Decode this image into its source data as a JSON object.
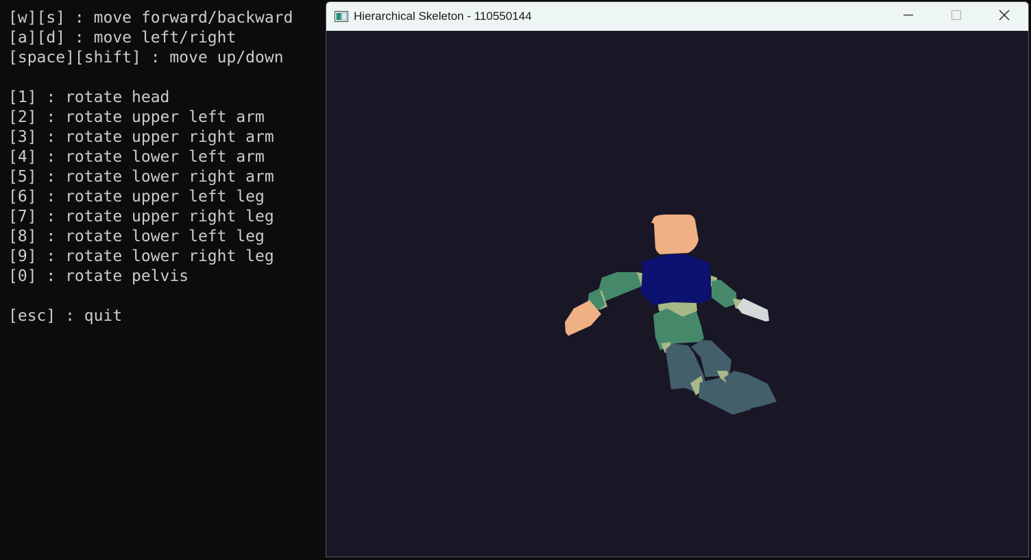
{
  "console": {
    "movement": [
      "[w][s] : move forward/backward",
      "[a][d] : move left/right",
      "[space][shift] : move up/down"
    ],
    "rotations": [
      "[1] : rotate head",
      "[2] : rotate upper left arm",
      "[3] : rotate upper right arm",
      "[4] : rotate lower left arm",
      "[5] : rotate lower right arm",
      "[6] : rotate upper left leg",
      "[7] : rotate upper right leg",
      "[8] : rotate lower left leg",
      "[9] : rotate lower right leg",
      "[0] : rotate pelvis"
    ],
    "quit": "[esc] : quit"
  },
  "window": {
    "title": "Hierarchical Skeleton - 110550144",
    "icon": "app-window-icon",
    "controls": [
      "minimize-icon",
      "maximize-icon",
      "close-icon"
    ]
  },
  "scene": {
    "background_color": "#191626",
    "colors": {
      "head": "#efb083",
      "torso": "#0d1170",
      "limb": "#45896a",
      "joint": "#a8b887",
      "leg": "#445f6c",
      "left_hand": "#efb083",
      "right_hand": "#d5d8d8"
    }
  }
}
